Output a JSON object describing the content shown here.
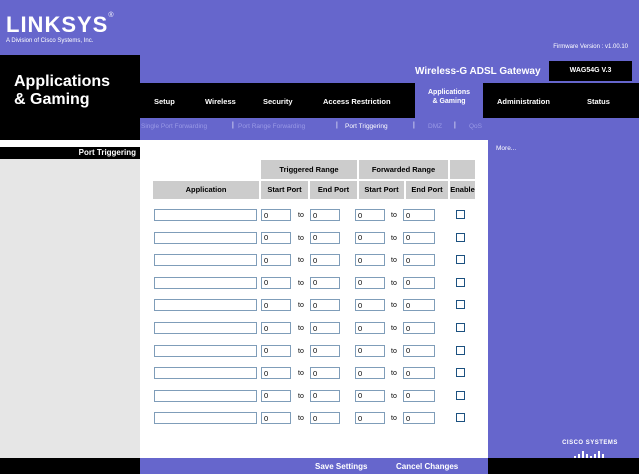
{
  "brand": {
    "logo": "LINKSYS",
    "logo_mark": "®",
    "division": "A Division of Cisco Systems, Inc."
  },
  "firmware": "Firmware Version : v1.00.10",
  "page_title_line1": "Applications",
  "page_title_line2": "& Gaming",
  "product_name": "Wireless-G ADSL Gateway",
  "model": "WAG54G V.3",
  "tabs": {
    "setup": "Setup",
    "wireless": "Wireless",
    "security": "Security",
    "access": "Access Restriction",
    "apps_line1": "Applications",
    "apps_line2": "& Gaming",
    "admin": "Administration",
    "status": "Status"
  },
  "subtabs": {
    "single": "Single Port Forwarding",
    "range": "Port Range Forwarding",
    "trigger": "Port Triggering",
    "dmz": "DMZ",
    "qos": "QoS",
    "sep": "|"
  },
  "section_title": "Port Triggering",
  "more": "More...",
  "table": {
    "triggered_range": "Triggered Range",
    "forwarded_range": "Forwarded Range",
    "application": "Application",
    "start_port": "Start Port",
    "end_port": "End Port",
    "enable": "Enable",
    "to": "to",
    "rows": [
      {
        "app": "",
        "ts": "0",
        "te": "0",
        "fs": "0",
        "fe": "0"
      },
      {
        "app": "",
        "ts": "0",
        "te": "0",
        "fs": "0",
        "fe": "0"
      },
      {
        "app": "",
        "ts": "0",
        "te": "0",
        "fs": "0",
        "fe": "0"
      },
      {
        "app": "",
        "ts": "0",
        "te": "0",
        "fs": "0",
        "fe": "0"
      },
      {
        "app": "",
        "ts": "0",
        "te": "0",
        "fs": "0",
        "fe": "0"
      },
      {
        "app": "",
        "ts": "0",
        "te": "0",
        "fs": "0",
        "fe": "0"
      },
      {
        "app": "",
        "ts": "0",
        "te": "0",
        "fs": "0",
        "fe": "0"
      },
      {
        "app": "",
        "ts": "0",
        "te": "0",
        "fs": "0",
        "fe": "0"
      },
      {
        "app": "",
        "ts": "0",
        "te": "0",
        "fs": "0",
        "fe": "0"
      },
      {
        "app": "",
        "ts": "0",
        "te": "0",
        "fs": "0",
        "fe": "0"
      }
    ]
  },
  "buttons": {
    "save": "Save Settings",
    "cancel": "Cancel Changes"
  },
  "cisco": "Cisco Systems",
  "colors": {
    "brand": "#6666cc",
    "dark": "#000000",
    "header": "#cccccc"
  }
}
